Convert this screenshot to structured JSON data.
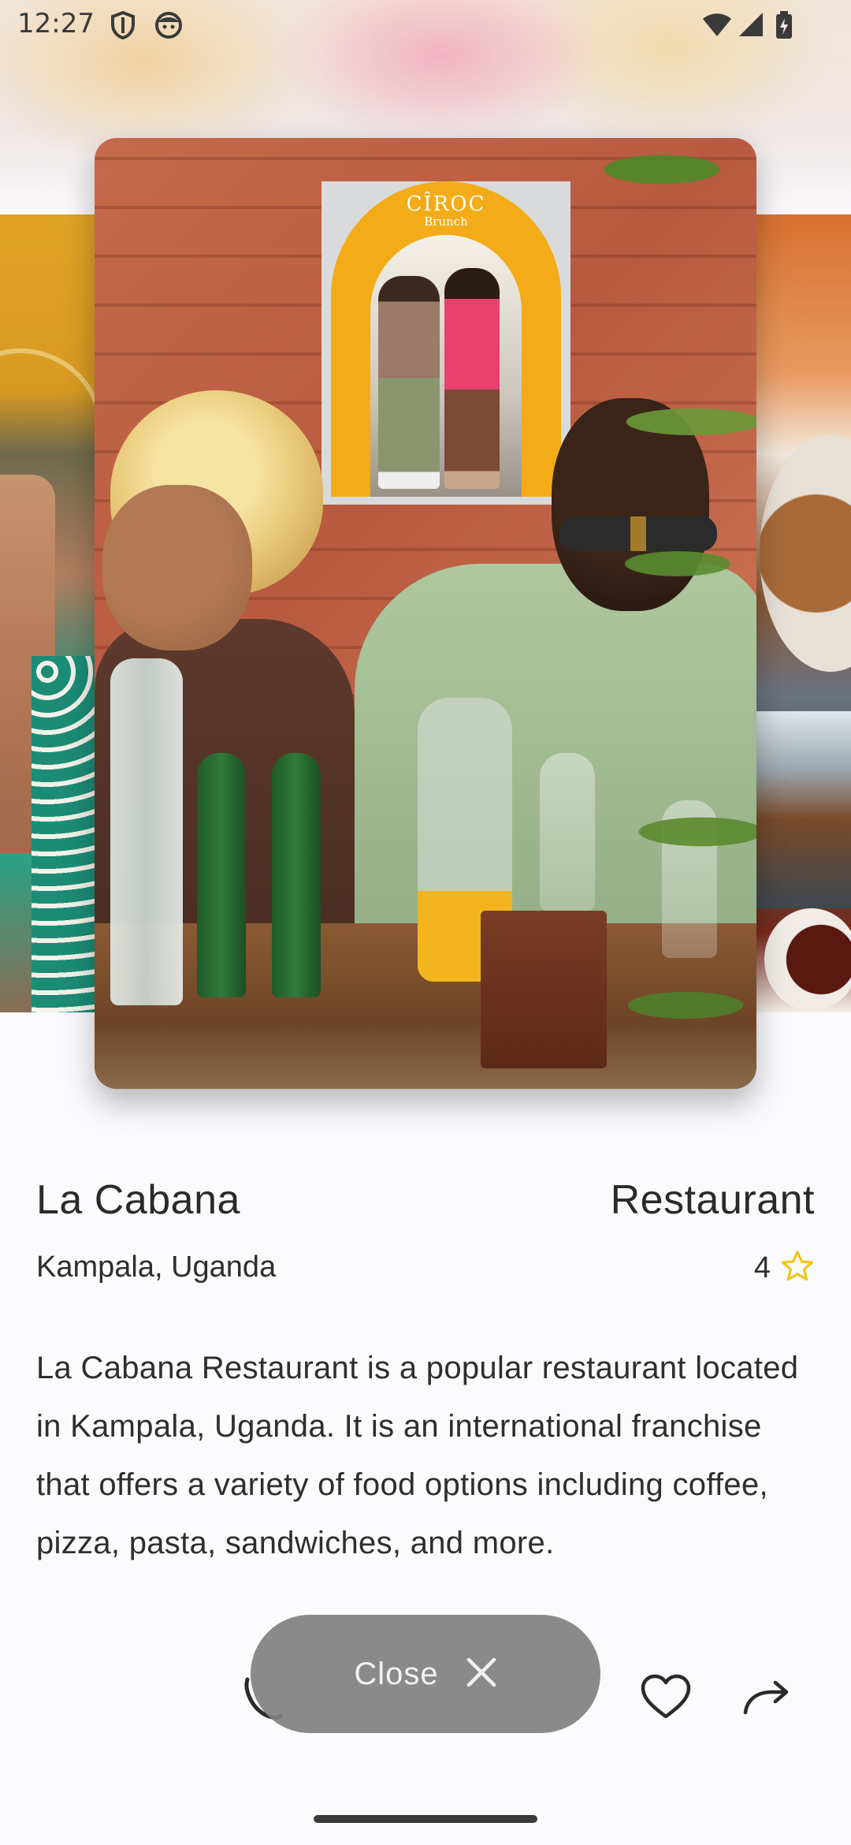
{
  "status_bar": {
    "time": "12:27",
    "icons": [
      "shield-icon",
      "face-icon",
      "wifi-icon",
      "signal-icon",
      "battery-icon"
    ]
  },
  "gallery": {
    "poster_brand": "CÎROC",
    "poster_subtitle": "Brunch"
  },
  "place": {
    "name": "La Cabana",
    "category": "Restaurant",
    "location": "Kampala, Uganda",
    "rating": "4",
    "rating_icon": "star-outline-icon",
    "description": "La Cabana Restaurant is a popular restaurant located in Kampala, Uganda. It is an international franchise that offers a variety of food options including coffee, pizza, pasta, sandwiches, and more."
  },
  "actions": {
    "close_label": "Close",
    "close_icon": "close-icon",
    "icons": [
      "phone-icon",
      "heart-icon",
      "share-icon"
    ]
  },
  "colors": {
    "accent_star": "#f2c418",
    "close_button_bg": "#808080",
    "text_primary": "#2a2a2a"
  }
}
